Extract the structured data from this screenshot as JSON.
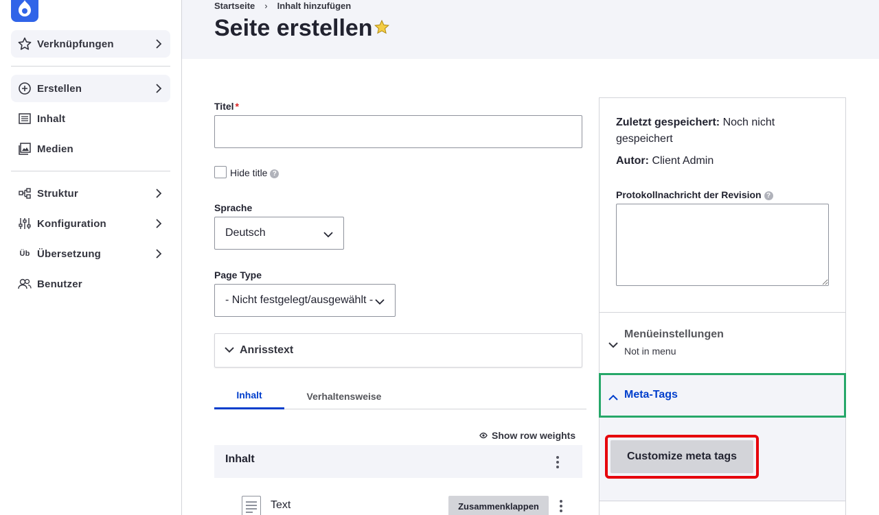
{
  "sidebar": {
    "items": [
      {
        "label": "Verknüpfungen"
      },
      {
        "label": "Erstellen"
      },
      {
        "label": "Inhalt"
      },
      {
        "label": "Medien"
      },
      {
        "label": "Struktur"
      },
      {
        "label": "Konfiguration"
      },
      {
        "label": "Übersetzung",
        "icon_text": "Üb"
      },
      {
        "label": "Benutzer"
      }
    ]
  },
  "header": {
    "breadcrumb": [
      "Startseite",
      "Inhalt hinzufügen"
    ],
    "title": "Seite erstellen"
  },
  "form": {
    "title_label": "Titel",
    "title_required": "*",
    "title_value": "",
    "hide_title_label": "Hide title",
    "help_glyph": "?",
    "language_label": "Sprache",
    "language_value": "Deutsch",
    "page_type_label": "Page Type",
    "page_type_value": "- Nicht festgelegt/ausgewählt -",
    "teaser_label": "Anrisstext",
    "tabs": [
      {
        "label": "Inhalt",
        "active": true
      },
      {
        "label": "Verhaltensweise",
        "active": false
      }
    ],
    "show_row_weights": "Show row weights",
    "table_header": "Inhalt",
    "row": {
      "label": "Text",
      "collapse_label": "Zusammenklappen"
    }
  },
  "meta": {
    "last_saved_label": "Zuletzt gespeichert:",
    "last_saved_value": "Noch nicht gespeichert",
    "author_label": "Autor:",
    "author_value": "Client Admin",
    "revision_label": "Protokollnachricht der Revision",
    "revision_value": "",
    "menu_settings_title": "Menüeinstellungen",
    "menu_settings_sub": "Not in menu",
    "meta_tags_title": "Meta-Tags",
    "customize_button": "Customize meta tags"
  },
  "colors": {
    "accent": "#003ecc",
    "logo": "#3064e8",
    "focus_green": "#26a769",
    "highlight_red": "#e6000b"
  }
}
